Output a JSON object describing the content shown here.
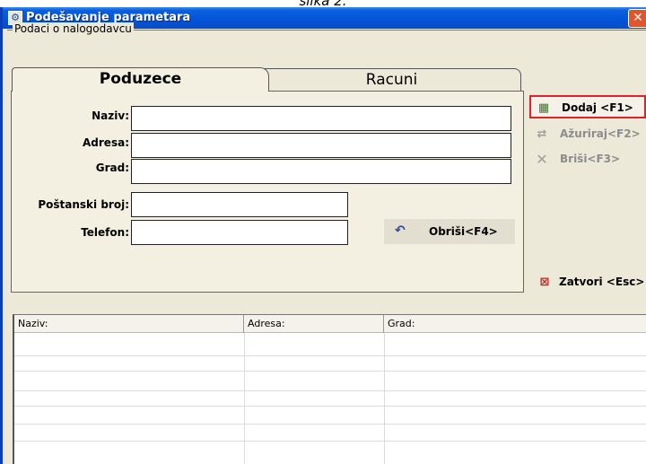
{
  "caption": "slika 2.",
  "window": {
    "title": "Podešavanje parametara",
    "close_glyph": "✕"
  },
  "group": {
    "legend": "Podaci o nalogodavcu"
  },
  "tabs": [
    {
      "label": "Poduzece",
      "active": true
    },
    {
      "label": "Racuni",
      "active": false
    }
  ],
  "form": {
    "fields": [
      {
        "label": "Naziv:",
        "value": ""
      },
      {
        "label": "Adresa:",
        "value": ""
      },
      {
        "label": "Grad:",
        "value": ""
      },
      {
        "label": "Poštanski broj:",
        "value": ""
      },
      {
        "label": "Telefon:",
        "value": ""
      }
    ],
    "clear_button": "Obriši<F4>"
  },
  "actions": {
    "add": "Dodaj <F1>",
    "update": "Ažuriraj<F2>",
    "delete": "Briši<F3>",
    "close": "Zatvori <Esc>"
  },
  "grid": {
    "columns": [
      "Naziv:",
      "Adresa:",
      "Grad:"
    ],
    "rows": []
  },
  "colors": {
    "titlebar": "#0454d8",
    "window_bg": "#ece9d8",
    "highlight_border": "#e0202a",
    "disabled_text": "#8c8c8c"
  },
  "icons": {
    "app": "app-icon",
    "close": "close-icon",
    "add": "add-record-icon",
    "update": "update-record-icon",
    "delete": "delete-x-icon",
    "undo": "undo-arrow-icon",
    "exit": "exit-door-icon"
  }
}
